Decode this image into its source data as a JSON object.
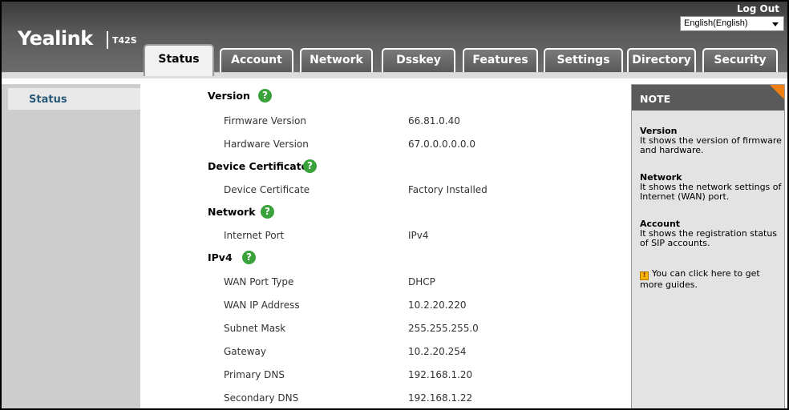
{
  "header": {
    "brand": "Yealink",
    "model": "T42S",
    "logout": "Log Out",
    "language": "English(English)"
  },
  "tabs": [
    {
      "label": "Status",
      "active": true
    },
    {
      "label": "Account",
      "active": false
    },
    {
      "label": "Network",
      "active": false
    },
    {
      "label": "Dsskey",
      "active": false
    },
    {
      "label": "Features",
      "active": false
    },
    {
      "label": "Settings",
      "active": false
    },
    {
      "label": "Directory",
      "active": false
    },
    {
      "label": "Security",
      "active": false
    }
  ],
  "sidebar": {
    "items": [
      {
        "label": "Status"
      }
    ]
  },
  "help_icon": {
    "glyph": "?",
    "name": "help-icon",
    "color": "#3aa23a"
  },
  "sections": {
    "version": {
      "title": "Version",
      "fields": [
        {
          "label": "Firmware Version",
          "value": "66.81.0.40"
        },
        {
          "label": "Hardware Version",
          "value": "67.0.0.0.0.0.0"
        }
      ]
    },
    "certificate": {
      "title": "Device Certificate",
      "fields": [
        {
          "label": "Device Certificate",
          "value": "Factory Installed"
        }
      ]
    },
    "network": {
      "title": "Network",
      "fields": [
        {
          "label": "Internet Port",
          "value": "IPv4"
        }
      ]
    },
    "ipv4": {
      "title": "IPv4",
      "fields": [
        {
          "label": "WAN Port Type",
          "value": "DHCP"
        },
        {
          "label": "WAN IP Address",
          "value": "10.2.20.220"
        },
        {
          "label": "Subnet Mask",
          "value": "255.255.255.0"
        },
        {
          "label": "Gateway",
          "value": "10.2.20.254"
        },
        {
          "label": "Primary DNS",
          "value": "192.168.1.20"
        },
        {
          "label": "Secondary DNS",
          "value": "192.168.1.22"
        }
      ]
    }
  },
  "note": {
    "title": "NOTE",
    "items": [
      {
        "title": "Version",
        "text": "It shows the version of firmware and hardware."
      },
      {
        "title": "Network",
        "text": "It shows the network settings of Internet (WAN) port."
      },
      {
        "title": "Account",
        "text": "It shows the registration status of SIP accounts."
      }
    ],
    "guide": "You can click here to get more guides."
  },
  "colors": {
    "accent_orange": "#f07f16",
    "header_dark": "#3b3b3b",
    "link_blue": "#2a5a78"
  }
}
